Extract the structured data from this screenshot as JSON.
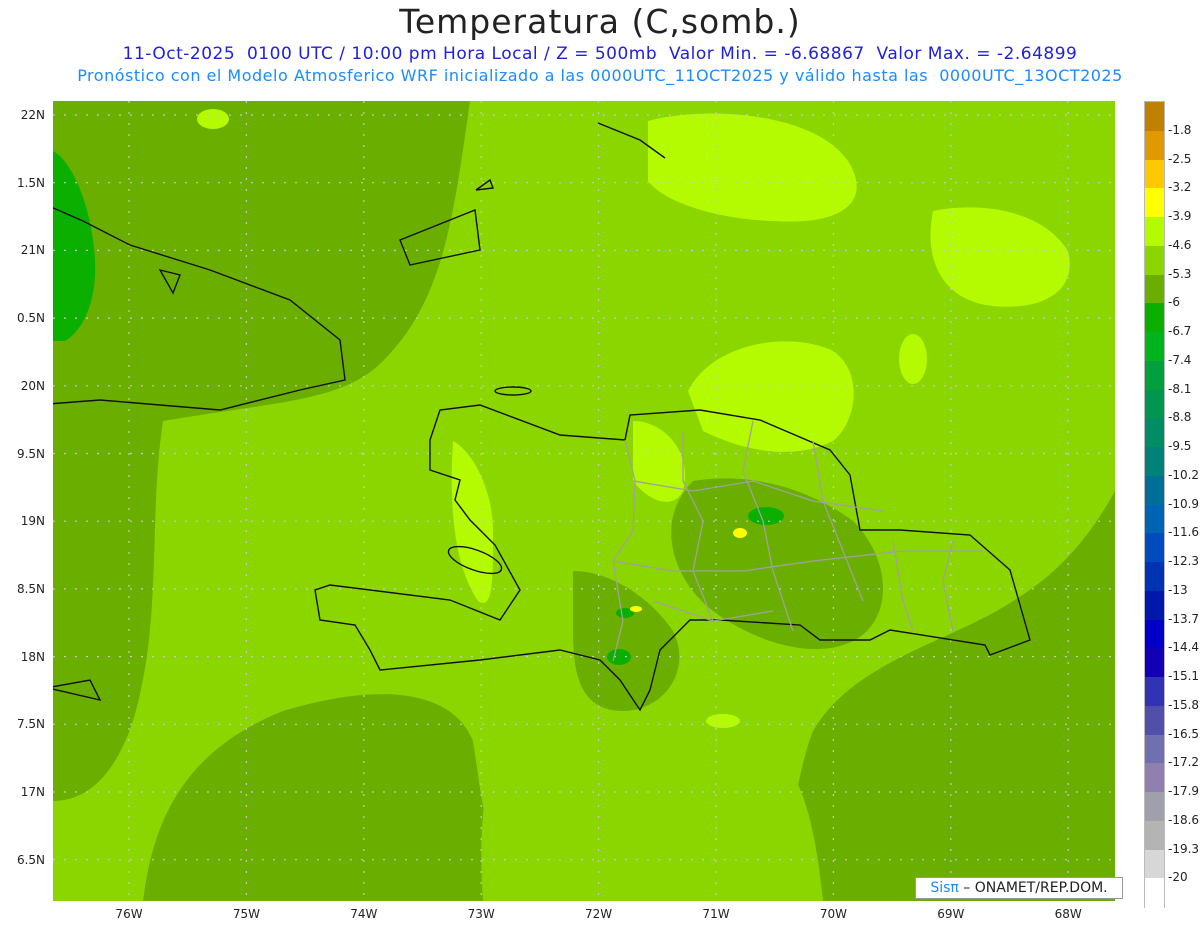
{
  "header": {
    "title": "Temperatura (C,somb.)",
    "line1": "11-Oct-2025  0100 UTC / 10:00 pm Hora Local / Z = 500mb  Valor Min. = -6.68867  Valor Max. = -2.64899",
    "line2": "Pronóstico con el Modelo Atmosferico WRF inicializado a las 0000UTC_11OCT2025 y válido hasta las  0000UTC_13OCT2025"
  },
  "axes": {
    "lat_labels": [
      "22N",
      "1.5N",
      "21N",
      "0.5N",
      "20N",
      "9.5N",
      "19N",
      "8.5N",
      "18N",
      "7.5N",
      "17N",
      "6.5N"
    ],
    "lon_labels": [
      "76W",
      "75W",
      "74W",
      "73W",
      "72W",
      "71W",
      "70W",
      "69W",
      "68W"
    ]
  },
  "colorbar": {
    "labels": [
      "-1.8",
      "-2.5",
      "-3.2",
      "-3.9",
      "-4.6",
      "-5.3",
      "-6",
      "-6.7",
      "-7.4",
      "-8.1",
      "-8.8",
      "-9.5",
      "-10.2",
      "-10.9",
      "-11.6",
      "-12.3",
      "-13",
      "-13.7",
      "-14.4",
      "-15.1",
      "-15.8",
      "-16.5",
      "-17.2",
      "-17.9",
      "-18.6",
      "-19.3",
      "-20"
    ],
    "colors": [
      "#c08000",
      "#e09a00",
      "#ffc800",
      "#ffff00",
      "#b4fa00",
      "#8cd600",
      "#6aaf00",
      "#0aaf00",
      "#00b41e",
      "#00a03c",
      "#009650",
      "#008c64",
      "#008278",
      "#006e96",
      "#0064b4",
      "#004bbe",
      "#0032b4",
      "#0019aa",
      "#0000c8",
      "#1400b4",
      "#3232b4",
      "#5050aa",
      "#7070b0",
      "#9080b0",
      "#a0a0aa",
      "#b4b4b4",
      "#d7d7d7",
      "#ffffff"
    ]
  },
  "logo": {
    "brand": "Sisπ",
    "text": " – ONAMET/REP.DOM."
  }
}
